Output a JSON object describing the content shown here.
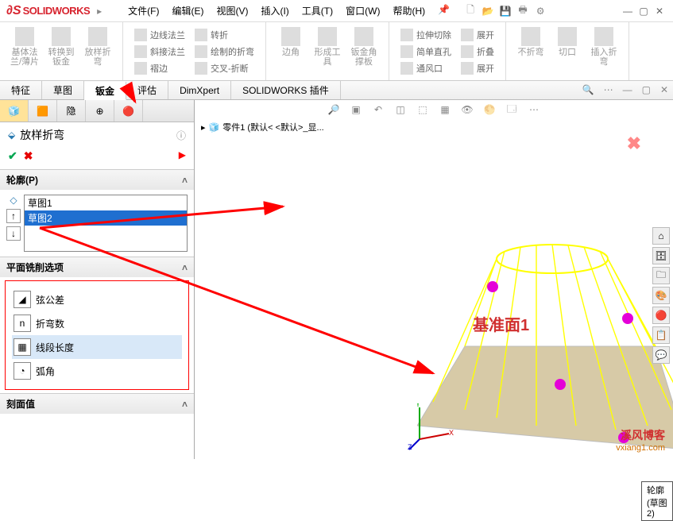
{
  "app": {
    "name": "SOLIDWORKS"
  },
  "menu": {
    "file": "文件(F)",
    "edit": "编辑(E)",
    "view": "视图(V)",
    "insert": "插入(I)",
    "tools": "工具(T)",
    "window": "窗口(W)",
    "help": "帮助(H)"
  },
  "ribbon": {
    "base_flange": "基体法\n兰/薄片",
    "convert_sm": "转换到\n钣金",
    "loft_bend": "放样折\n弯",
    "edge_flange": "边线法兰",
    "miter_flange": "斜接法兰",
    "hem": "褶边",
    "jog": "转折",
    "sketched_bend": "绘制的折弯",
    "cross_break": "交叉-折断",
    "corners": "边角",
    "forming_tool": "形成工\n具",
    "corner_gusset": "钣金角\n撑板",
    "ext_cut": "拉伸切除",
    "simple_hole": "简单直孔",
    "vent": "通风口",
    "unfold": "展开",
    "fold": "折叠",
    "no_bend": "不折弯",
    "rip": "切口",
    "insert_bends": "插入折\n弯",
    "expand2": "展开"
  },
  "tabs": {
    "features": "特征",
    "sketch": "草图",
    "sheetmetal": "钣金",
    "evaluate": "评估",
    "dimxpert": "DimXpert",
    "plugins": "SOLIDWORKS 插件"
  },
  "pm": {
    "title": "放样折弯",
    "profile_hdr": "轮廓(P)",
    "sketch1": "草图1",
    "sketch2": "草图2",
    "opts_hdr": "平面铣削选项",
    "opt_chord": "弦公差",
    "opt_bends": "折弯数",
    "opt_seglen": "线段长度",
    "opt_arc": "弧角",
    "facet_hdr": "刻面值"
  },
  "view": {
    "breadcrumb": "零件1  (默认< <默认>_显...",
    "callout": "轮廓(草图 2)",
    "annot": "基准面1"
  },
  "wm": {
    "l1": "溪风博客",
    "l2": "vxiang1.com"
  }
}
